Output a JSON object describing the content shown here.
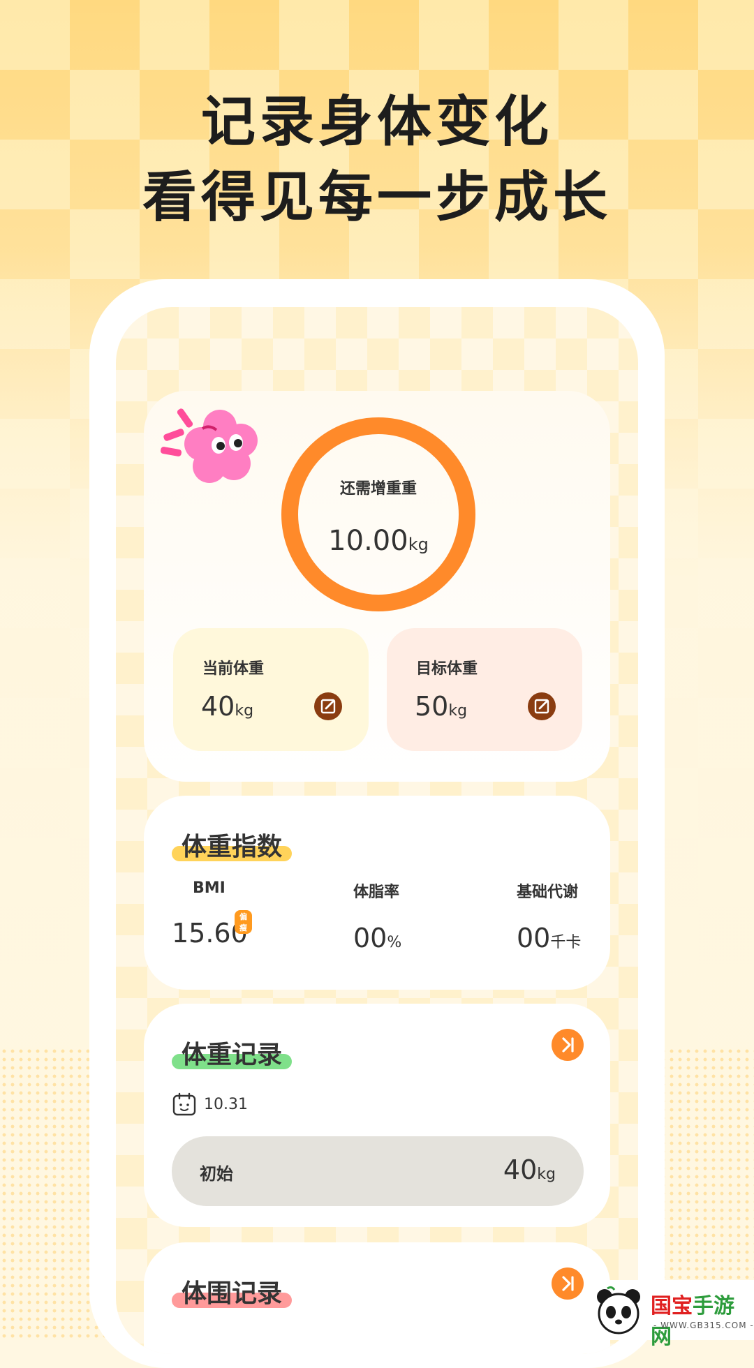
{
  "headline": {
    "line1": "记录身体变化",
    "line2": "看得见每一步成长"
  },
  "summary": {
    "ring_label": "还需增重重",
    "ring_value": "10.00",
    "ring_unit": "kg",
    "current": {
      "label": "当前体重",
      "value": "40",
      "unit": "kg"
    },
    "target": {
      "label": "目标体重",
      "value": "50",
      "unit": "kg"
    }
  },
  "bmi_section": {
    "title": "体重指数",
    "bmi": {
      "label": "BMI",
      "value": "15.60",
      "badge": "偏瘦"
    },
    "body_fat": {
      "label": "体脂率",
      "value": "00",
      "unit": "%"
    },
    "bmr": {
      "label": "基础代谢",
      "value": "00",
      "unit": "千卡"
    }
  },
  "weight_record": {
    "title": "体重记录",
    "date": "10.31",
    "entry": {
      "label": "初始",
      "value": "40",
      "unit": "kg"
    }
  },
  "girth_record": {
    "title": "体围记录"
  },
  "watermark": {
    "brand_red": "国宝",
    "brand_green": "手游网",
    "url": "- WWW.GB315.COM -"
  },
  "colors": {
    "accent_orange": "#ff8a2a",
    "edit_brown": "#8a3c10",
    "title_highlight_yellow": "#ffd35a",
    "title_highlight_green": "#7fe08a",
    "title_highlight_pink": "#ff9a9a"
  }
}
